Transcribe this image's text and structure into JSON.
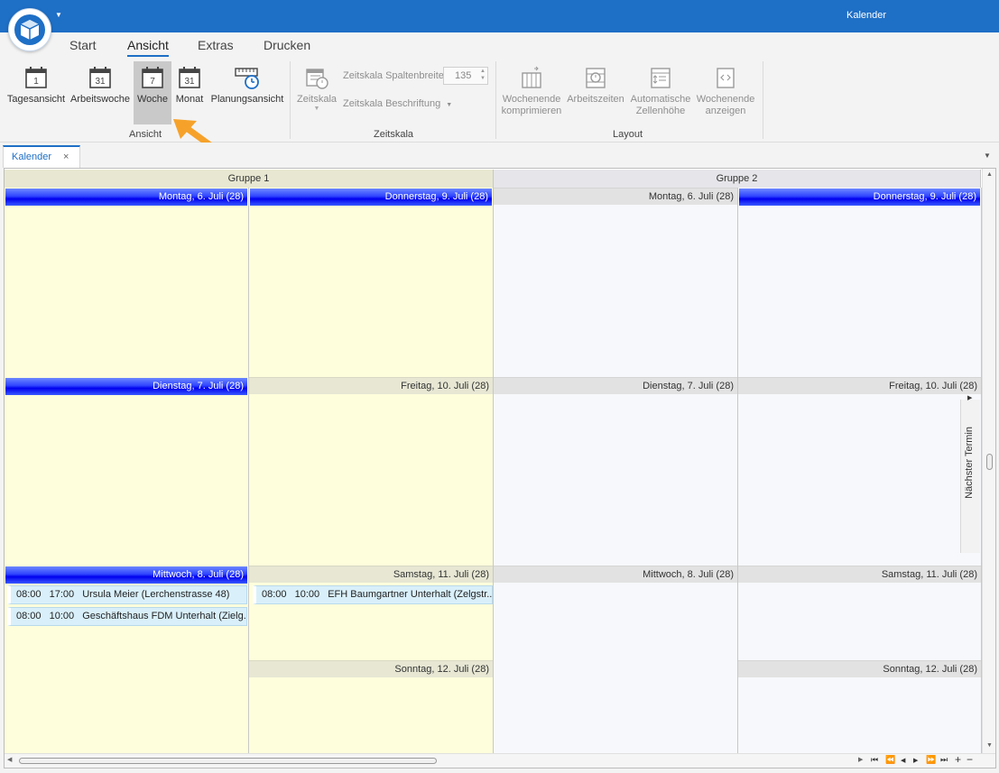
{
  "window": {
    "title": "Kalender"
  },
  "ribbon_tabs": [
    "Start",
    "Ansicht",
    "Extras",
    "Drucken"
  ],
  "ribbon": {
    "ansicht": {
      "label": "Ansicht",
      "buttons": [
        "Tagesansicht",
        "Arbeitswoche",
        "Woche",
        "Monat",
        "Planungsansicht"
      ],
      "selected": "Woche"
    },
    "zeitskala": {
      "label": "Zeitskala",
      "button": "Zeitskala",
      "spaltenbreite_label": "Zeitskala Spaltenbreite",
      "spaltenbreite_value": "135",
      "beschriftung_label": "Zeitskala Beschriftung"
    },
    "layout": {
      "label": "Layout",
      "buttons": [
        [
          "Wochenende",
          "komprimieren"
        ],
        [
          "Arbeitszeiten",
          ""
        ],
        [
          "Automatische",
          "Zellenhöhe"
        ],
        [
          "Wochenende",
          "anzeigen"
        ]
      ]
    }
  },
  "doc_tab": {
    "label": "Kalender",
    "close": "×"
  },
  "calendar": {
    "groups": [
      "Gruppe 1",
      "Gruppe 2"
    ],
    "group1": {
      "monday": "Montag, 6. Juli (28)",
      "tuesday": "Dienstag, 7. Juli (28)",
      "wednesday": "Mittwoch, 8. Juli (28)",
      "thursday": "Donnerstag, 9. Juli (28)",
      "friday": "Freitag, 10. Juli (28)",
      "saturday": "Samstag, 11. Juli (28)",
      "sunday": "Sonntag, 12. Juli (28)"
    },
    "group2": {
      "monday": "Montag, 6. Juli (28)",
      "tuesday": "Dienstag, 7. Juli (28)",
      "wednesday": "Mittwoch, 8. Juli (28)",
      "thursday": "Donnerstag, 9. Juli (28)",
      "friday": "Freitag, 10. Juli (28)",
      "saturday": "Samstag, 11. Juli (28)",
      "sunday": "Sonntag, 12. Juli (28)"
    },
    "appointments": [
      {
        "start": "08:00",
        "end": "17:00",
        "subject": "Ursula Meier (Lerchenstrasse 48)"
      },
      {
        "start": "08:00",
        "end": "10:00",
        "subject": "Geschäftshaus FDM Unterhalt (Zielg..."
      },
      {
        "start": "08:00",
        "end": "10:00",
        "subject": "EFH Baumgartner Unterhalt (Zelgstr..."
      }
    ],
    "next_appointment": "Nächster Termin"
  },
  "colors": {
    "accent": "#1e6fc6",
    "group1_bg": "#fefedc",
    "selected_day_header": "#0000ee"
  }
}
